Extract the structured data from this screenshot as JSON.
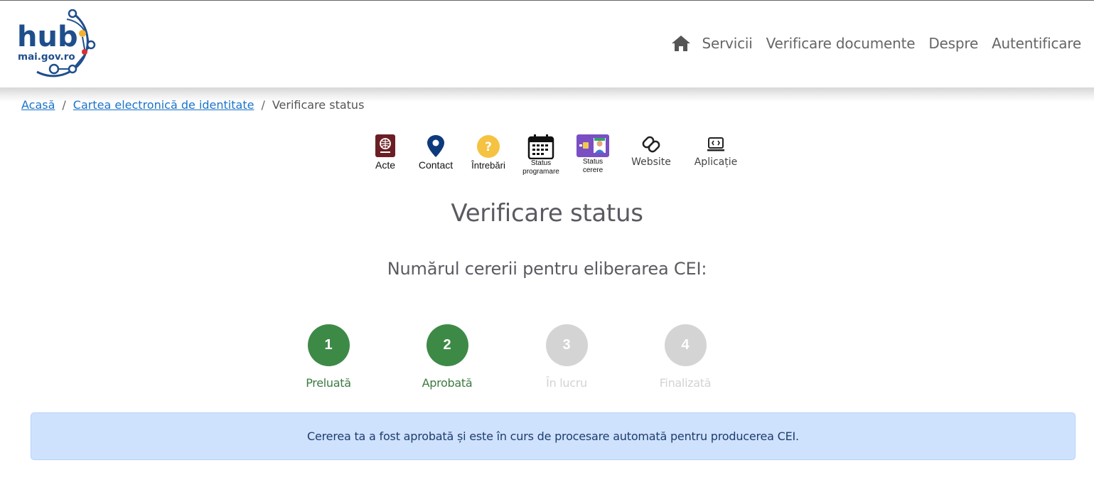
{
  "logo": {
    "line1": "hub",
    "line2": "mai.gov.ro"
  },
  "nav": {
    "items": [
      "Servicii",
      "Verificare documente",
      "Despre",
      "Autentificare"
    ],
    "home_icon": "home-icon"
  },
  "breadcrumb": {
    "items": [
      "Acasă",
      "Cartea electronică de identitate",
      "Verificare status"
    ],
    "separator": "/"
  },
  "quick_links": [
    {
      "label": "Acte",
      "icon": "passport-icon"
    },
    {
      "label": "Contact",
      "icon": "location-pin-icon"
    },
    {
      "label": "Întrebări",
      "icon": "question-icon"
    },
    {
      "label_line1": "Status",
      "label_line2": "programare",
      "icon": "calendar-icon"
    },
    {
      "label_line1": "Status",
      "label_line2": "cerere",
      "icon": "id-card-icon"
    },
    {
      "label": "Website",
      "icon": "link-icon"
    },
    {
      "label": "Aplicație",
      "icon": "app-icon"
    }
  ],
  "page": {
    "title": "Verificare status",
    "subtitle": "Numărul cererii pentru eliberarea CEI:"
  },
  "steps": [
    {
      "number": "1",
      "label": "Preluată",
      "state": "done"
    },
    {
      "number": "2",
      "label": "Aprobată",
      "state": "done"
    },
    {
      "number": "3",
      "label": "În lucru",
      "state": "todo"
    },
    {
      "number": "4",
      "label": "Finalizată",
      "state": "todo"
    }
  ],
  "alert": {
    "message": "Cererea ta a fost aprobată și este în curs de procesare automată pentru producerea CEI."
  },
  "colors": {
    "done": "#3d8a47",
    "todo": "#d4d4d4",
    "link": "#1a73c9",
    "alert_bg": "#cfe2fd",
    "logo_blue": "#1f4e8c"
  }
}
